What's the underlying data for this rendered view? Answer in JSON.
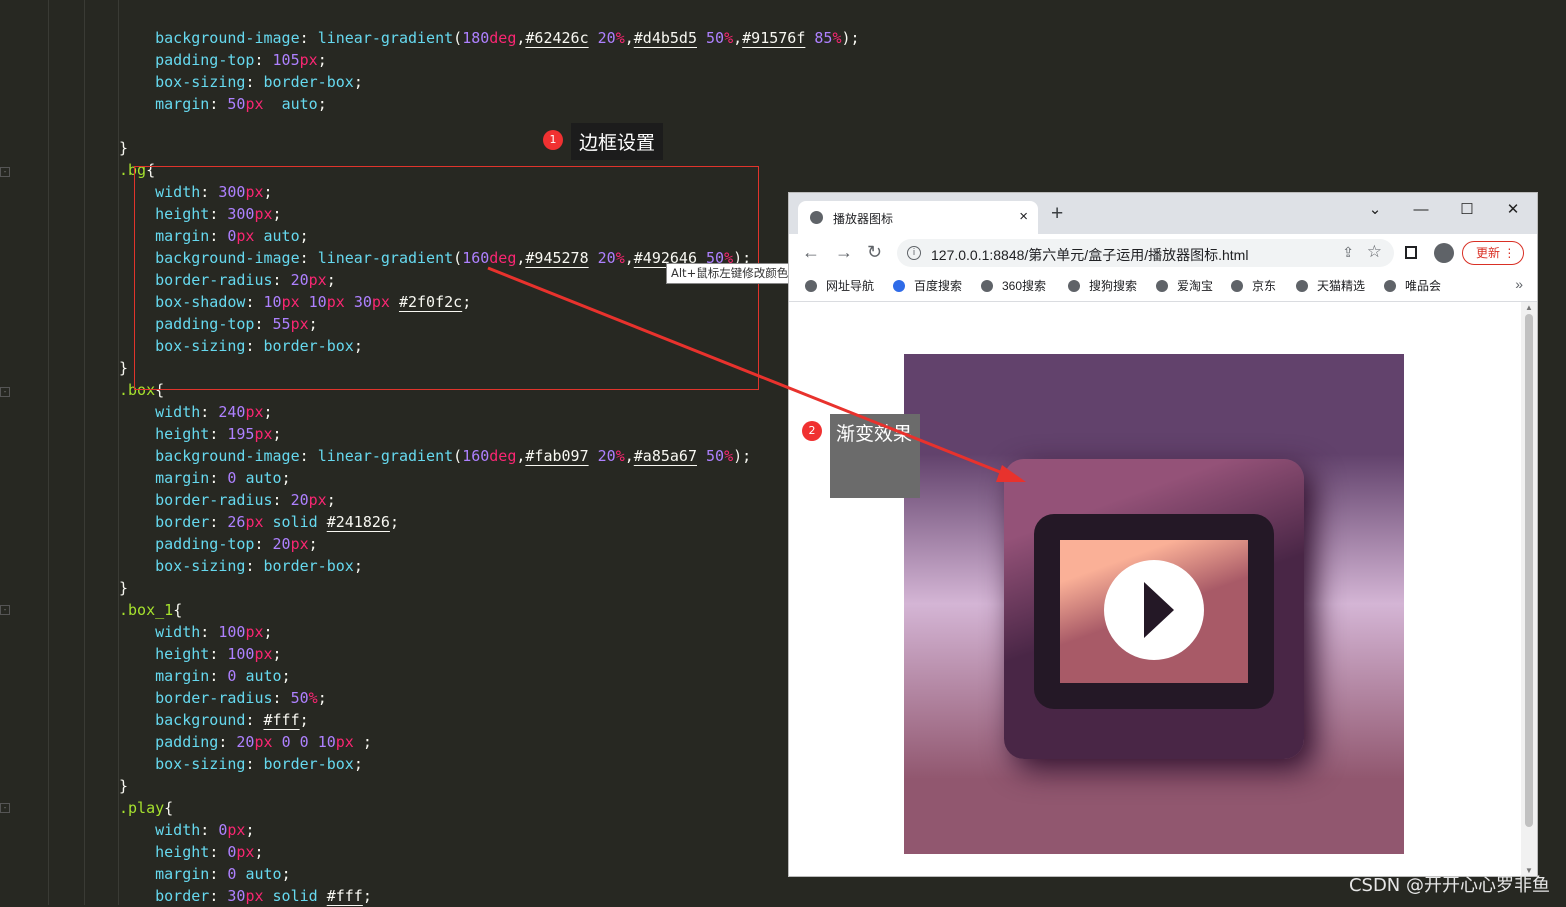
{
  "editor": {
    "lines": [
      [
        [
          "    background-image",
          "prop"
        ],
        [
          ": ",
          ""
        ],
        [
          "linear-gradient",
          "fn"
        ],
        [
          "(",
          ""
        ],
        [
          "180",
          "num"
        ],
        [
          "deg",
          "unit"
        ],
        [
          ",",
          ""
        ],
        [
          "#62426c",
          "hex"
        ],
        [
          " ",
          ""
        ],
        [
          "20",
          "num"
        ],
        [
          "%",
          "unit"
        ],
        [
          ",",
          ""
        ],
        [
          "#d4b5d5",
          "hex"
        ],
        [
          " ",
          ""
        ],
        [
          "50",
          "num"
        ],
        [
          "%",
          "unit"
        ],
        [
          ",",
          ""
        ],
        [
          "#91576f",
          "hex"
        ],
        [
          " ",
          ""
        ],
        [
          "85",
          "num"
        ],
        [
          "%",
          "unit"
        ],
        [
          ");",
          ""
        ]
      ],
      [
        [
          "    padding-top",
          "prop"
        ],
        [
          ": ",
          ""
        ],
        [
          "105",
          "num"
        ],
        [
          "px",
          "unit"
        ],
        [
          ";",
          ""
        ]
      ],
      [
        [
          "    box-sizing",
          "prop"
        ],
        [
          ": ",
          ""
        ],
        [
          "border-box",
          "fn"
        ],
        [
          ";",
          ""
        ]
      ],
      [
        [
          "    margin",
          "prop"
        ],
        [
          ": ",
          ""
        ],
        [
          "50",
          "num"
        ],
        [
          "px",
          "unit"
        ],
        [
          "  ",
          ""
        ],
        [
          "auto",
          "fn"
        ],
        [
          ";",
          ""
        ]
      ],
      [
        [
          "",
          ""
        ]
      ],
      [
        [
          "}",
          ""
        ]
      ],
      [
        [
          ".bg",
          "sel"
        ],
        [
          "{",
          ""
        ]
      ],
      [
        [
          "    width",
          "prop"
        ],
        [
          ": ",
          ""
        ],
        [
          "300",
          "num"
        ],
        [
          "px",
          "unit"
        ],
        [
          ";",
          ""
        ]
      ],
      [
        [
          "    height",
          "prop"
        ],
        [
          ": ",
          ""
        ],
        [
          "300",
          "num"
        ],
        [
          "px",
          "unit"
        ],
        [
          ";",
          ""
        ]
      ],
      [
        [
          "    margin",
          "prop"
        ],
        [
          ": ",
          ""
        ],
        [
          "0",
          "num"
        ],
        [
          "px",
          "unit"
        ],
        [
          " ",
          ""
        ],
        [
          "auto",
          "fn"
        ],
        [
          ";",
          ""
        ]
      ],
      [
        [
          "    background-image",
          "prop"
        ],
        [
          ": ",
          ""
        ],
        [
          "linear-gradient",
          "fn"
        ],
        [
          "(",
          ""
        ],
        [
          "160",
          "num"
        ],
        [
          "deg",
          "unit"
        ],
        [
          ",",
          ""
        ],
        [
          "#945278",
          "hex"
        ],
        [
          " ",
          ""
        ],
        [
          "20",
          "num"
        ],
        [
          "%",
          "unit"
        ],
        [
          ",",
          ""
        ],
        [
          "#492646",
          "hex"
        ],
        [
          " ",
          ""
        ],
        [
          "50",
          "num"
        ],
        [
          "%",
          "unit"
        ],
        [
          ");",
          ""
        ]
      ],
      [
        [
          "    border-radius",
          "prop"
        ],
        [
          ": ",
          ""
        ],
        [
          "20",
          "num"
        ],
        [
          "px",
          "unit"
        ],
        [
          ";",
          ""
        ]
      ],
      [
        [
          "    box-shadow",
          "prop"
        ],
        [
          ": ",
          ""
        ],
        [
          "10",
          "num"
        ],
        [
          "px",
          "unit"
        ],
        [
          " ",
          ""
        ],
        [
          "10",
          "num"
        ],
        [
          "px",
          "unit"
        ],
        [
          " ",
          ""
        ],
        [
          "30",
          "num"
        ],
        [
          "px",
          "unit"
        ],
        [
          " ",
          ""
        ],
        [
          "#2f0f2c",
          "hex"
        ],
        [
          ";",
          ""
        ]
      ],
      [
        [
          "    padding-top",
          "prop"
        ],
        [
          ": ",
          ""
        ],
        [
          "55",
          "num"
        ],
        [
          "px",
          "unit"
        ],
        [
          ";",
          ""
        ]
      ],
      [
        [
          "    box-sizing",
          "prop"
        ],
        [
          ": ",
          ""
        ],
        [
          "border-box",
          "fn"
        ],
        [
          ";",
          ""
        ]
      ],
      [
        [
          "}",
          ""
        ]
      ],
      [
        [
          ".box",
          "sel"
        ],
        [
          "{",
          ""
        ]
      ],
      [
        [
          "    width",
          "prop"
        ],
        [
          ": ",
          ""
        ],
        [
          "240",
          "num"
        ],
        [
          "px",
          "unit"
        ],
        [
          ";",
          ""
        ]
      ],
      [
        [
          "    height",
          "prop"
        ],
        [
          ": ",
          ""
        ],
        [
          "195",
          "num"
        ],
        [
          "px",
          "unit"
        ],
        [
          ";",
          ""
        ]
      ],
      [
        [
          "    background-image",
          "prop"
        ],
        [
          ": ",
          ""
        ],
        [
          "linear-gradient",
          "fn"
        ],
        [
          "(",
          ""
        ],
        [
          "160",
          "num"
        ],
        [
          "deg",
          "unit"
        ],
        [
          ",",
          ""
        ],
        [
          "#fab097",
          "hex"
        ],
        [
          " ",
          ""
        ],
        [
          "20",
          "num"
        ],
        [
          "%",
          "unit"
        ],
        [
          ",",
          ""
        ],
        [
          "#a85a67",
          "hex"
        ],
        [
          " ",
          ""
        ],
        [
          "50",
          "num"
        ],
        [
          "%",
          "unit"
        ],
        [
          ");",
          ""
        ]
      ],
      [
        [
          "    margin",
          "prop"
        ],
        [
          ": ",
          ""
        ],
        [
          "0",
          "num"
        ],
        [
          " ",
          ""
        ],
        [
          "auto",
          "fn"
        ],
        [
          ";",
          ""
        ]
      ],
      [
        [
          "    border-radius",
          "prop"
        ],
        [
          ": ",
          ""
        ],
        [
          "20",
          "num"
        ],
        [
          "px",
          "unit"
        ],
        [
          ";",
          ""
        ]
      ],
      [
        [
          "    border",
          "prop"
        ],
        [
          ": ",
          ""
        ],
        [
          "26",
          "num"
        ],
        [
          "px",
          "unit"
        ],
        [
          " ",
          ""
        ],
        [
          "solid",
          "fn"
        ],
        [
          " ",
          ""
        ],
        [
          "#241826",
          "hex"
        ],
        [
          ";",
          ""
        ]
      ],
      [
        [
          "    padding-top",
          "prop"
        ],
        [
          ": ",
          ""
        ],
        [
          "20",
          "num"
        ],
        [
          "px",
          "unit"
        ],
        [
          ";",
          ""
        ]
      ],
      [
        [
          "    box-sizing",
          "prop"
        ],
        [
          ": ",
          ""
        ],
        [
          "border-box",
          "fn"
        ],
        [
          ";",
          ""
        ]
      ],
      [
        [
          "}",
          ""
        ]
      ],
      [
        [
          ".box_1",
          "sel"
        ],
        [
          "{",
          ""
        ]
      ],
      [
        [
          "    width",
          "prop"
        ],
        [
          ": ",
          ""
        ],
        [
          "100",
          "num"
        ],
        [
          "px",
          "unit"
        ],
        [
          ";",
          ""
        ]
      ],
      [
        [
          "    height",
          "prop"
        ],
        [
          ": ",
          ""
        ],
        [
          "100",
          "num"
        ],
        [
          "px",
          "unit"
        ],
        [
          ";",
          ""
        ]
      ],
      [
        [
          "    margin",
          "prop"
        ],
        [
          ": ",
          ""
        ],
        [
          "0",
          "num"
        ],
        [
          " ",
          ""
        ],
        [
          "auto",
          "fn"
        ],
        [
          ";",
          ""
        ]
      ],
      [
        [
          "    border-radius",
          "prop"
        ],
        [
          ": ",
          ""
        ],
        [
          "50",
          "num"
        ],
        [
          "%",
          "unit"
        ],
        [
          ";",
          ""
        ]
      ],
      [
        [
          "    background",
          "prop"
        ],
        [
          ": ",
          ""
        ],
        [
          "#fff",
          "hex"
        ],
        [
          ";",
          ""
        ]
      ],
      [
        [
          "    padding",
          "prop"
        ],
        [
          ": ",
          ""
        ],
        [
          "20",
          "num"
        ],
        [
          "px",
          "unit"
        ],
        [
          " ",
          ""
        ],
        [
          "0",
          "num"
        ],
        [
          " ",
          ""
        ],
        [
          "0",
          "num"
        ],
        [
          " ",
          ""
        ],
        [
          "10",
          "num"
        ],
        [
          "px",
          "unit"
        ],
        [
          " ;",
          ""
        ]
      ],
      [
        [
          "    box-sizing",
          "prop"
        ],
        [
          ": ",
          ""
        ],
        [
          "border-box",
          "fn"
        ],
        [
          ";",
          ""
        ]
      ],
      [
        [
          "}",
          ""
        ]
      ],
      [
        [
          ".play",
          "sel"
        ],
        [
          "{",
          ""
        ]
      ],
      [
        [
          "    width",
          "prop"
        ],
        [
          ": ",
          ""
        ],
        [
          "0",
          "num"
        ],
        [
          "px",
          "unit"
        ],
        [
          ";",
          ""
        ]
      ],
      [
        [
          "    height",
          "prop"
        ],
        [
          ": ",
          ""
        ],
        [
          "0",
          "num"
        ],
        [
          "px",
          "unit"
        ],
        [
          ";",
          ""
        ]
      ],
      [
        [
          "    margin",
          "prop"
        ],
        [
          ": ",
          ""
        ],
        [
          "0",
          "num"
        ],
        [
          " ",
          ""
        ],
        [
          "auto",
          "fn"
        ],
        [
          ";",
          ""
        ]
      ],
      [
        [
          "    border",
          "prop"
        ],
        [
          ": ",
          ""
        ],
        [
          "30",
          "num"
        ],
        [
          "px",
          "unit"
        ],
        [
          " ",
          ""
        ],
        [
          "solid",
          "fn"
        ],
        [
          " ",
          ""
        ],
        [
          "#fff",
          "hex"
        ],
        [
          ";",
          ""
        ]
      ]
    ]
  },
  "tooltip": "Alt+鼠标左键修改颜色值",
  "annotations": [
    {
      "number": "1",
      "text": "边框设置"
    },
    {
      "number": "2",
      "text": "渐变效果"
    }
  ],
  "browser": {
    "tab_title": "播放器图标",
    "tab_close": "×",
    "new_tab": "+",
    "url": "127.0.0.1:8848/第六单元/盒子运用/播放器图标.html",
    "update_button": "更新",
    "update_menu": "⋮",
    "window_buttons": [
      "⌄",
      "—",
      "☐",
      "✕"
    ],
    "nav": {
      "back": "←",
      "forward": "→",
      "reload": "↻"
    },
    "bookmarks": [
      "网址导航",
      "百度搜索",
      "360搜索",
      "搜狗搜索",
      "爱淘宝",
      "京东",
      "天猫精选",
      "唯品会"
    ],
    "bookmarks_more": "»"
  },
  "colors": {
    "bg_gradient": [
      "#62426c",
      "#d4b5d5",
      "#91576f"
    ],
    "card_gradient": [
      "#945278",
      "#492646"
    ],
    "screen_gradient": [
      "#fab097",
      "#a85a67"
    ],
    "frame_border": "#241826",
    "shadow": "#2f0f2c",
    "annotation_red": "#f03131"
  },
  "watermark": "CSDN @开开心心罗非鱼"
}
